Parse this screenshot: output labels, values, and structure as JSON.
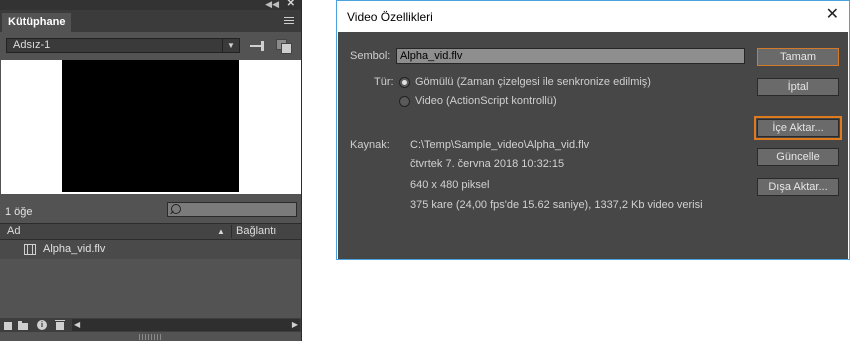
{
  "library": {
    "tab": "Kütüphane",
    "topbar": {
      "collapse_icon": "double-chevron-left-icon",
      "close_icon": "close-icon"
    },
    "document_select": {
      "value": "Adsız-1"
    },
    "item_count": "1 öğe",
    "columns": {
      "name": "Ad",
      "linkage": "Bağlantı"
    },
    "items": [
      {
        "name": "Alpha_vid.flv",
        "icon": "video-clip-icon"
      }
    ]
  },
  "dialog": {
    "title": "Video Özellikleri",
    "symbol_label": "Sembol:",
    "symbol_value": "Alpha_vid.flv",
    "type_label": "Tür:",
    "type_options": [
      {
        "label": "Gömülü (Zaman çizelgesi ile senkronize edilmiş)",
        "selected": true
      },
      {
        "label": "Video (ActionScript kontrollü)",
        "selected": false
      }
    ],
    "source_label": "Kaynak:",
    "source_lines": [
      "C:\\Temp\\Sample_video\\Alpha_vid.flv",
      "čtvrtek 7. června 2018  10:32:15",
      "640 x 480 piksel",
      "375 kare (24,00 fps'de 15.62 saniye), 1337,2 Kb video verisi"
    ],
    "buttons": {
      "ok": "Tamam",
      "cancel": "İptal",
      "import": "İçe Aktar...",
      "update": "Güncelle",
      "export": "Dışa Aktar..."
    }
  },
  "colors": {
    "panel_bg": "#535353",
    "dialog_bg": "#474747",
    "accent_orange": "#e07a1f"
  }
}
